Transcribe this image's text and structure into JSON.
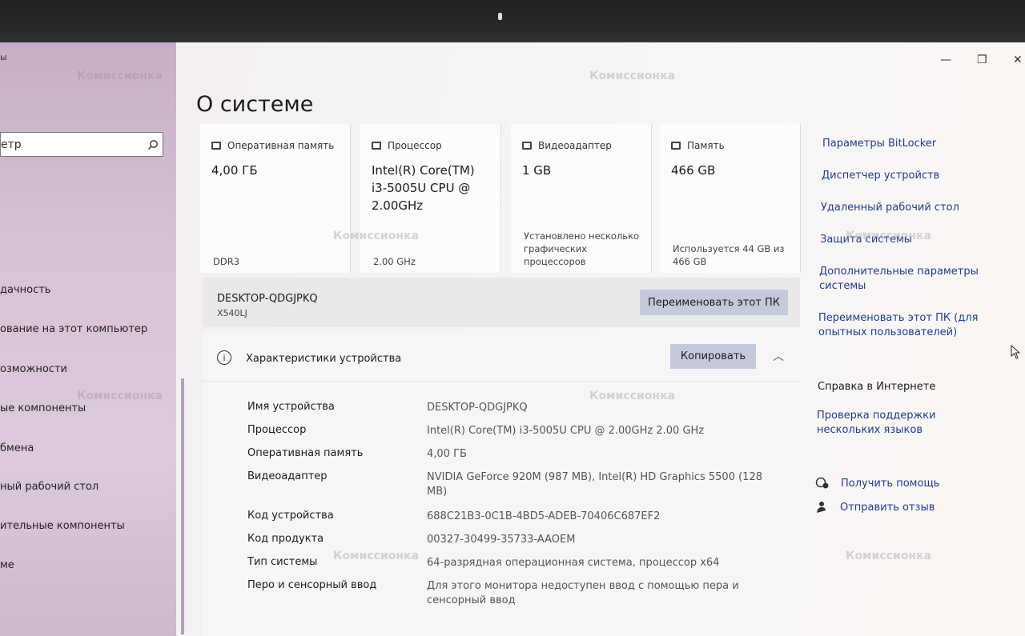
{
  "window": {
    "title_fragment": "ы",
    "page_title": "О системе"
  },
  "sidebar": {
    "search_value": "етр",
    "items": [
      "дачность",
      "ование на этот компьютер",
      "озможности",
      "ые компоненты",
      "бмена",
      "ный рабочий стол",
      "ительные компоненты",
      "ме"
    ]
  },
  "cards": [
    {
      "label": "Оперативная память",
      "value": "4,00 ГБ",
      "sub": "DDR3"
    },
    {
      "label": "Процессор",
      "value": "Intel(R) Core(TM) i3-5005U CPU @ 2.00GHz",
      "sub": "2.00 GHz"
    },
    {
      "label": "Видеоадаптер",
      "value": "1 GB",
      "sub": "Установлено несколько графических процессоров"
    },
    {
      "label": "Память",
      "value": "466 GB",
      "sub": "Используется 44 GB из 466 GB"
    }
  ],
  "namebar": {
    "device_name": "DESKTOP-QDGJPKQ",
    "model": "X540LJ",
    "rename_label": "Переименовать этот ПК"
  },
  "specs": {
    "header": "Характеристики устройства",
    "copy_label": "Копировать",
    "rows": [
      {
        "key": "Имя устройства",
        "value": "DESKTOP-QDGJPKQ"
      },
      {
        "key": "Процессор",
        "value": "Intel(R) Core(TM) i3-5005U CPU @ 2.00GHz   2.00 GHz"
      },
      {
        "key": "Оперативная память",
        "value": "4,00 ГБ"
      },
      {
        "key": "Видеоадаптер",
        "value": "NVIDIA GeForce 920M (987 MB), Intel(R) HD Graphics 5500 (128 MB)"
      },
      {
        "key": "Код устройства",
        "value": "688C21B3-0C1B-4BD5-ADEB-70406C687EF2"
      },
      {
        "key": "Код продукта",
        "value": "00327-30499-35733-AAOEM"
      },
      {
        "key": "Тип системы",
        "value": "64-разрядная операционная система, процессор x64"
      },
      {
        "key": "Перо и сенсорный ввод",
        "value": "Для этого монитора недоступен ввод с помощью пера и сенсорный ввод"
      }
    ]
  },
  "related": {
    "links": [
      "Параметры BitLocker",
      "Диспетчер устройств",
      "Удаленный рабочий стол",
      "Защита системы",
      "Дополнительные параметры системы",
      "Переименовать этот ПК (для опытных пользователей)"
    ],
    "help_header": "Справка в Интернете",
    "help_link": "Проверка поддержки нескольких языков",
    "get_help": "Получить помощь",
    "feedback": "Отправить отзыв"
  },
  "watermark": "Комиссионка",
  "colors": {
    "accent_link": "#1f3c8c",
    "button": "#c5c9dc",
    "sidebar": "#d7c2d6"
  }
}
